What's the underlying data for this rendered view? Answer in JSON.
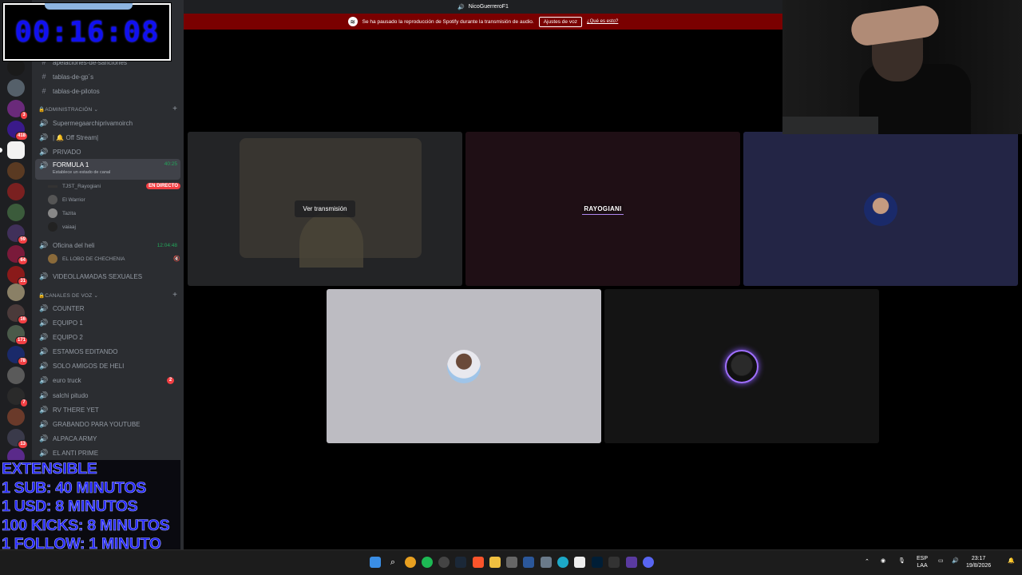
{
  "window": {
    "title": "NicoGuerreroF1"
  },
  "notice": {
    "text": "Se ha pausado la reproducción de Spotify durante la transmisión de audio.",
    "button": "Ajustes de voz",
    "link": "¿Qué es esto?"
  },
  "overlay": {
    "timer": "00:16:08",
    "extensible": [
      "EXTENSIBLE",
      "1 SUB: 40 MINUTOS",
      "1 USD: 8 MINUTOS",
      "100 KICKS: 8 MINUTOS",
      "1 FOLLOW: 1 MINUTO"
    ]
  },
  "server_rail": {
    "badges": [
      "3",
      "418",
      "59",
      "64",
      "31",
      "16",
      "171",
      "78",
      "7",
      "13"
    ]
  },
  "channels": {
    "top": [
      {
        "name": "apelaciones-de-sanciones"
      },
      {
        "name": "tablas-de-gp´s"
      },
      {
        "name": "tablas-de-pilotos"
      }
    ],
    "admin_category": "ADMINISTRACIÓN",
    "admin": [
      {
        "name": "Supermegaarchiprivamoirch"
      },
      {
        "name": "| 🔔 Off Stream|"
      },
      {
        "name": "PRIVADO"
      }
    ],
    "active": {
      "name": "FORMULA 1",
      "status": "Establece un estado de canal",
      "time": "40:25"
    },
    "users": [
      {
        "name": "TJST_Rayogiani",
        "live": "EN DIRECTO"
      },
      {
        "name": "El Warrior"
      },
      {
        "name": "Tazita"
      },
      {
        "name": "vaiaaj"
      }
    ],
    "oficina": {
      "name": "Oficina del heli",
      "time": "12:04:48",
      "user": "EL LOBO DE CHECHENIA"
    },
    "videollamadas": "VIDEOLLAMADAS SEXUALES",
    "voice_category": "CANALES DE VOZ",
    "voice": [
      {
        "name": "COUNTER"
      },
      {
        "name": "EQUIPO 1"
      },
      {
        "name": "EQUIPO 2"
      },
      {
        "name": "ESTAMOS EDITANDO"
      },
      {
        "name": "SOLO AMIGOS DE HELI"
      },
      {
        "name": "euro truck",
        "badge": "2"
      },
      {
        "name": "salchi pitudo"
      },
      {
        "name": "RV THERE YET"
      },
      {
        "name": "GRABANDO PARA YOUTUBE"
      },
      {
        "name": "ALPACA ARMY"
      },
      {
        "name": "EL ANTI PRIME"
      }
    ]
  },
  "stage": {
    "watch_button": "Ver transmisión",
    "rayogiani_label": "RAYOGIANI"
  },
  "taskbar": {
    "lang": [
      "ESP",
      "LAA"
    ],
    "time": "23:17",
    "date": "19/8/2026"
  },
  "colors": {
    "discord_bg": "#2b2d31",
    "rail_bg": "#1e1f22",
    "notice_red": "#7a0000",
    "live_red": "#f23f43",
    "timer_blue": "#1010f0"
  }
}
